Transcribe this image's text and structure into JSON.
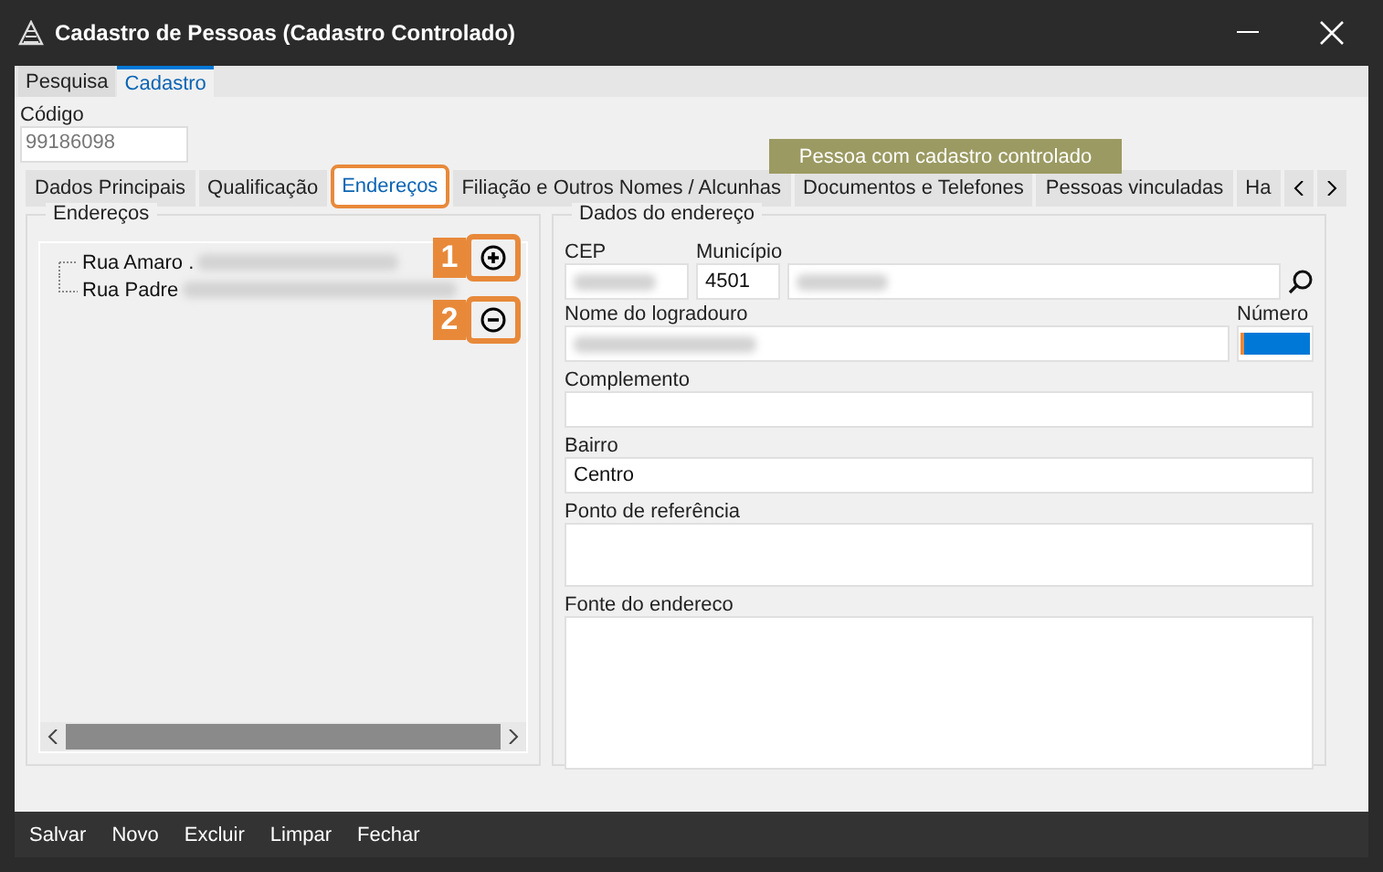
{
  "window": {
    "title": "Cadastro de Pessoas (Cadastro Controlado)"
  },
  "top_tabs": [
    {
      "label": "Pesquisa",
      "selected": false
    },
    {
      "label": "Cadastro",
      "selected": true
    }
  ],
  "codigo": {
    "label": "Código",
    "value": "99186098"
  },
  "banner": "Pessoa com cadastro controlado",
  "tabs": [
    {
      "label": "Dados Principais",
      "selected": false,
      "highlighted": false
    },
    {
      "label": "Qualificação",
      "selected": false,
      "highlighted": false
    },
    {
      "label": "Endereços",
      "selected": true,
      "highlighted": true
    },
    {
      "label": "Filiação e Outros Nomes / Alcunhas",
      "selected": false,
      "highlighted": false
    },
    {
      "label": "Documentos e Telefones",
      "selected": false,
      "highlighted": false
    },
    {
      "label": "Pessoas vinculadas",
      "selected": false,
      "highlighted": false
    },
    {
      "label": "Ha",
      "selected": false,
      "highlighted": false
    }
  ],
  "enderecos": {
    "title": "Endereços",
    "items": [
      {
        "label": "Rua Amaro ."
      },
      {
        "label": "Rua Padre"
      }
    ],
    "callouts": [
      {
        "number": "1",
        "kind": "add"
      },
      {
        "number": "2",
        "kind": "remove"
      }
    ]
  },
  "dados": {
    "title": "Dados do endereço",
    "cep": {
      "label": "CEP"
    },
    "municipio": {
      "label": "Município",
      "code": "4501"
    },
    "logradouro": {
      "label": "Nome do logradouro"
    },
    "numero": {
      "label": "Número"
    },
    "complemento": {
      "label": "Complemento"
    },
    "bairro": {
      "label": "Bairro",
      "value": "Centro"
    },
    "referencia": {
      "label": "Ponto de referência"
    },
    "fonte": {
      "label": "Fonte do endereco"
    }
  },
  "footer": [
    "Salvar",
    "Novo",
    "Excluir",
    "Limpar",
    "Fechar"
  ]
}
